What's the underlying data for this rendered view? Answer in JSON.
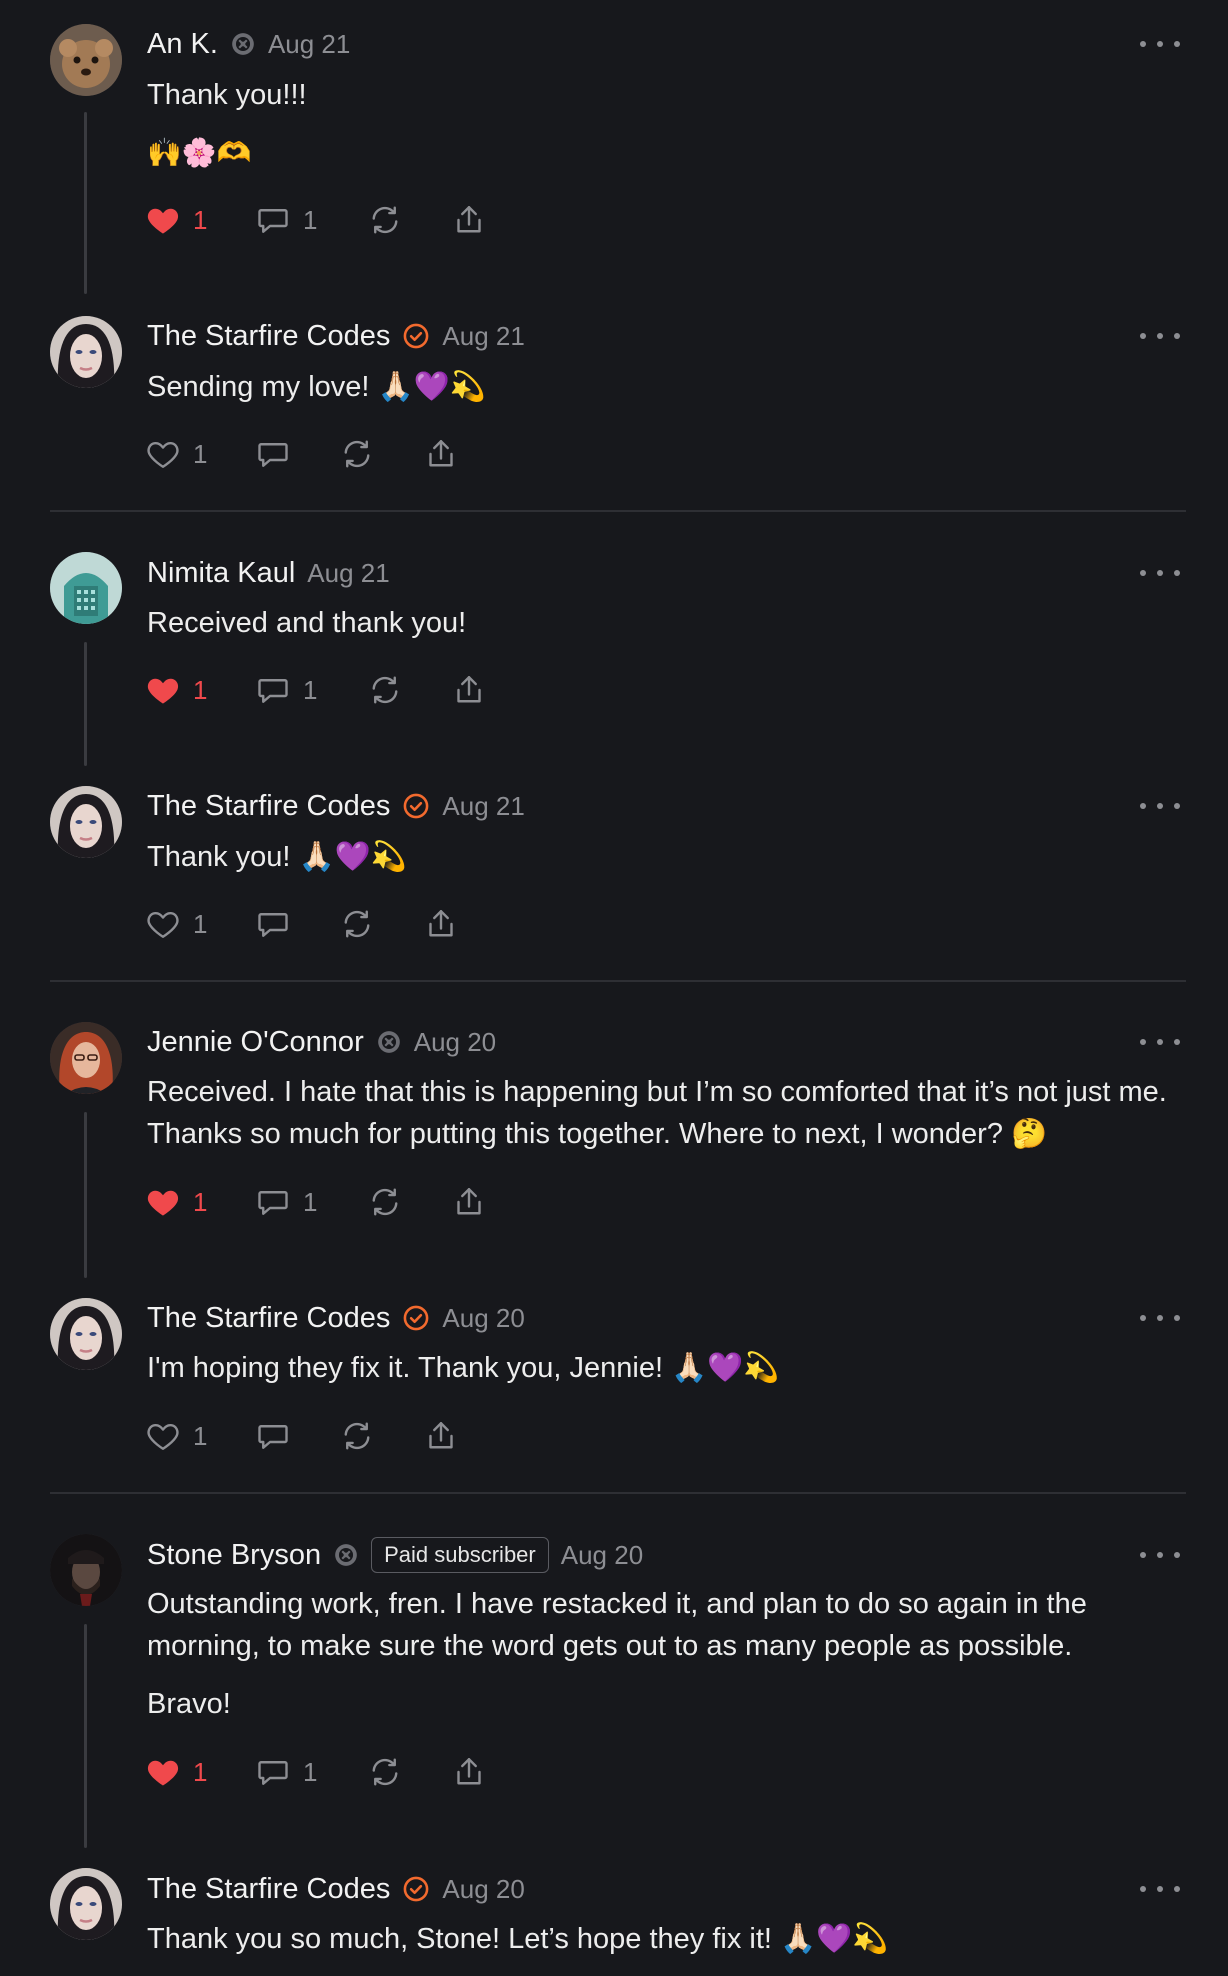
{
  "colors": {
    "background": "#17181c",
    "like": "#f0494c",
    "verified": "#f26a2e",
    "muted": "#8d8e93"
  },
  "comments": [
    {
      "name": "An K.",
      "date": "Aug 21",
      "body": [
        "Thank you!!!",
        "🙌🌸🫶"
      ],
      "likes": "1",
      "replies": "1",
      "liked": true,
      "subscriber": true
    },
    {
      "name": "The Starfire Codes",
      "date": "Aug 21",
      "body": [
        "Sending my love! 🙏🏻💜💫"
      ],
      "likes": "1",
      "replies": "",
      "liked": false,
      "verified": true
    },
    {
      "name": "Nimita Kaul",
      "date": "Aug 21",
      "body": [
        "Received and thank you!"
      ],
      "likes": "1",
      "replies": "1",
      "liked": true
    },
    {
      "name": "The Starfire Codes",
      "date": "Aug 21",
      "body": [
        "Thank you! 🙏🏻💜💫"
      ],
      "likes": "1",
      "replies": "",
      "liked": false,
      "verified": true
    },
    {
      "name": "Jennie O'Connor",
      "date": "Aug 20",
      "body": [
        "Received. I hate that this is happening but I’m so comforted that it’s not just me. Thanks so much for putting this together. Where to next, I wonder? 🤔"
      ],
      "likes": "1",
      "replies": "1",
      "liked": true,
      "subscriber": true
    },
    {
      "name": "The Starfire Codes",
      "date": "Aug 20",
      "body": [
        "I'm hoping they fix it. Thank you, Jennie! 🙏🏻💜💫"
      ],
      "likes": "1",
      "replies": "",
      "liked": false,
      "verified": true
    },
    {
      "name": "Stone Bryson",
      "date": "Aug 20",
      "badge": "Paid subscriber",
      "body": [
        "Outstanding work, fren. I have restacked it, and plan to do so again in the morning, to make sure the word gets out to as many people as possible.",
        "Bravo!"
      ],
      "likes": "1",
      "replies": "1",
      "liked": true,
      "subscriber": true
    },
    {
      "name": "The Starfire Codes",
      "date": "Aug 20",
      "body": [
        "Thank you so much, Stone! Let’s hope they fix it! 🙏🏻💜💫"
      ],
      "verified": true
    }
  ]
}
